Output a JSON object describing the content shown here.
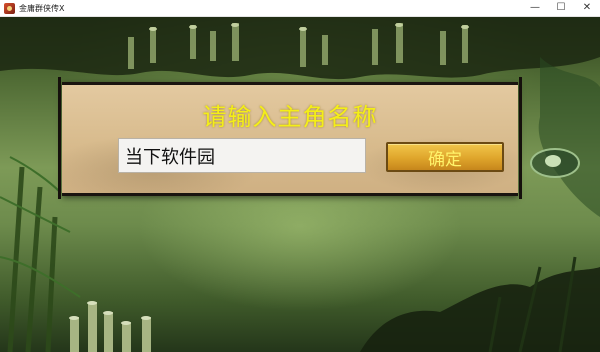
{
  "window": {
    "title": "金庸群侠传X",
    "minimize_glyph": "—",
    "maximize_glyph": "☐",
    "close_glyph": "✕"
  },
  "dialog": {
    "title": "请输入主角名称",
    "name_value": "当下软件园",
    "confirm_label": "确定"
  },
  "colors": {
    "title_yellow": "#f4ee18",
    "button_gold": "#dfa52b",
    "parchment": "#d8bb8d"
  },
  "icons": {
    "app": "game-app-icon"
  }
}
